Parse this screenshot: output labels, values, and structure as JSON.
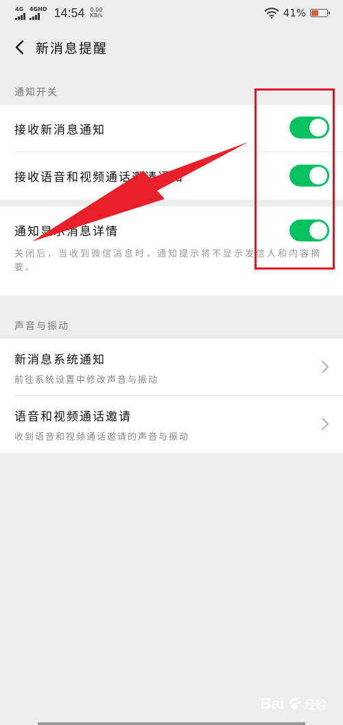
{
  "status_bar": {
    "sim1": "4G",
    "sim2": "4GHD",
    "time": "14:54",
    "speed_value": "0.00",
    "speed_unit": "KB/s",
    "battery": "41%",
    "battery_level": 0.41
  },
  "nav": {
    "title": "新消息提醒"
  },
  "notifications_section": {
    "header": "通知开关",
    "items": [
      {
        "label": "接收新消息通知",
        "enabled": true
      },
      {
        "label": "接收语音和视频通话邀请通知",
        "enabled": true
      }
    ],
    "detail_item": {
      "label": "通知显示消息详情",
      "enabled": true,
      "description": "关闭后，当收到微信消息时，通知提示将不显示发信人和内容摘要。"
    }
  },
  "sound_section": {
    "header": "声音与振动",
    "items": [
      {
        "label": "新消息系统通知",
        "sublabel": "前往系统设置中修改声音与振动"
      },
      {
        "label": "语音和视频通话邀请",
        "sublabel": "收到语音和视频通话邀请的声音与振动"
      }
    ]
  },
  "watermark": {
    "brand": "Bai",
    "suffix": "经验"
  },
  "colors": {
    "accent_green": "#07c160",
    "annotation_red": "#e3101e",
    "background": "#ededed"
  }
}
